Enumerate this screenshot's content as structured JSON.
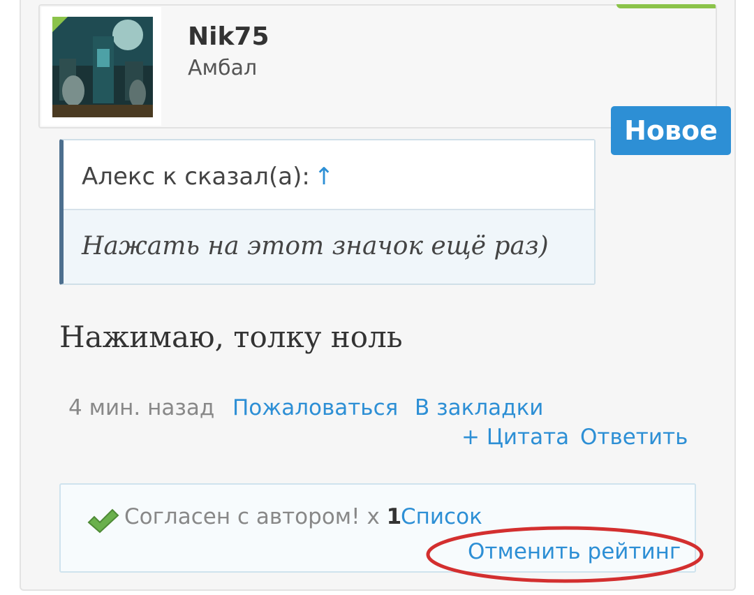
{
  "user": {
    "name": "Nik75",
    "title": "Амбал",
    "avatar_icon": "avatar-image"
  },
  "new_badge": "Новое",
  "quote": {
    "author_line": "Алекс к сказал(а):",
    "arrow": "↑",
    "text": "Нажать на этот значок ещё раз)"
  },
  "message": "Нажимаю, толку ноль",
  "meta": {
    "time": "4 мин. назад",
    "report": "Пожаловаться",
    "bookmark": "В закладки",
    "quote": "+ Цитата",
    "reply": "Ответить"
  },
  "rating": {
    "icon": "check-icon",
    "text": "Согласен с автором! x",
    "count": "1",
    "list": "Список",
    "cancel": "Отменить рейтинг"
  },
  "colors": {
    "accent": "#2d8fd5",
    "annotation": "#d32f2f",
    "online": "#8bc34a"
  }
}
